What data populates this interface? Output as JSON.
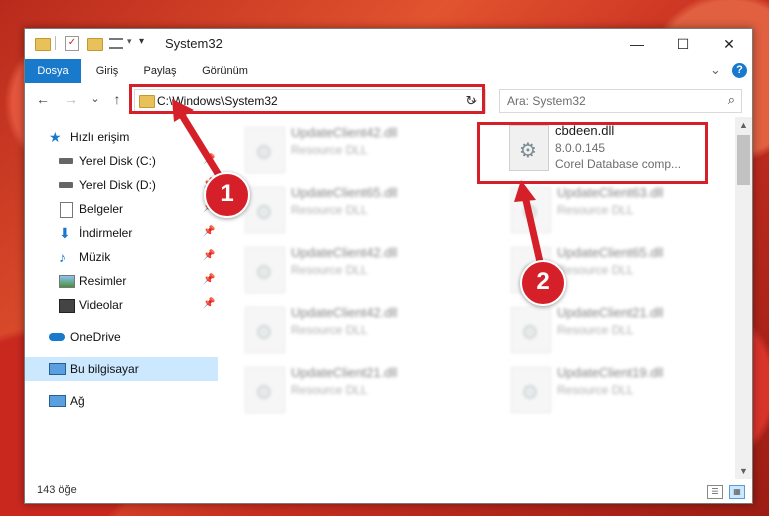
{
  "window": {
    "title": "System32",
    "minimize_glyph": "—",
    "maximize_glyph": "☐",
    "close_glyph": "✕"
  },
  "ribbon": {
    "tabs": [
      "Dosya",
      "Giriş",
      "Paylaş",
      "Görünüm"
    ],
    "expand_glyph": "⌄",
    "help_glyph": "?"
  },
  "navigation": {
    "back_glyph": "←",
    "forward_glyph": "→",
    "recent_glyph": "⌄",
    "up_glyph": "↑",
    "address": "C:\\Windows\\System32",
    "address_dropdown_glyph": "⌄",
    "refresh_glyph": "↻",
    "search_placeholder": "Ara: System32",
    "search_icon_glyph": "⌕"
  },
  "sidebar": {
    "items": [
      {
        "label": "Hızlı erişim",
        "icon": "star-icon"
      },
      {
        "label": "Yerel Disk (C:)",
        "icon": "drive-icon"
      },
      {
        "label": "Yerel Disk (D:)",
        "icon": "drive-icon"
      },
      {
        "label": "Belgeler",
        "icon": "documents-icon"
      },
      {
        "label": "İndirmeler",
        "icon": "download-icon"
      },
      {
        "label": "Müzik",
        "icon": "music-icon"
      },
      {
        "label": "Resimler",
        "icon": "pictures-icon"
      },
      {
        "label": "Videolar",
        "icon": "videos-icon"
      },
      {
        "label": "OneDrive",
        "icon": "cloud-icon"
      },
      {
        "label": "Bu bilgisayar",
        "icon": "computer-icon"
      },
      {
        "label": "Ağ",
        "icon": "network-icon"
      }
    ],
    "pin_glyph": "📌"
  },
  "files": {
    "highlighted": {
      "name": "cbdeen.dll",
      "version": "8.0.0.145",
      "description": "Corel Database comp..."
    },
    "left_column": [
      {
        "name": "UpdateClient42.dll",
        "type": "Resource DLL"
      },
      {
        "name": "UpdateClient65.dll",
        "type": "Resource DLL"
      },
      {
        "name": "UpdateClient42.dll",
        "type": "Resource DLL"
      },
      {
        "name": "UpdateClient42.dll",
        "type": "Resource DLL"
      },
      {
        "name": "UpdateClient21.dll",
        "type": "Resource DLL"
      }
    ],
    "right_column": [
      {
        "name": "UpdateClient63.dll",
        "type": "Resource DLL"
      },
      {
        "name": "UpdateClient65.dll",
        "type": "Resource DLL"
      },
      {
        "name": "UpdateClient21.dll",
        "type": "Resource DLL"
      },
      {
        "name": "UpdateClient19.dll",
        "type": "Resource DLL"
      }
    ]
  },
  "status": {
    "count": "143 öğe"
  },
  "annotations": {
    "badge_1": "1",
    "badge_2": "2",
    "highlight_color": "#d5202a"
  },
  "colors": {
    "accent": "#1979ca",
    "selection": "#cce8ff"
  }
}
